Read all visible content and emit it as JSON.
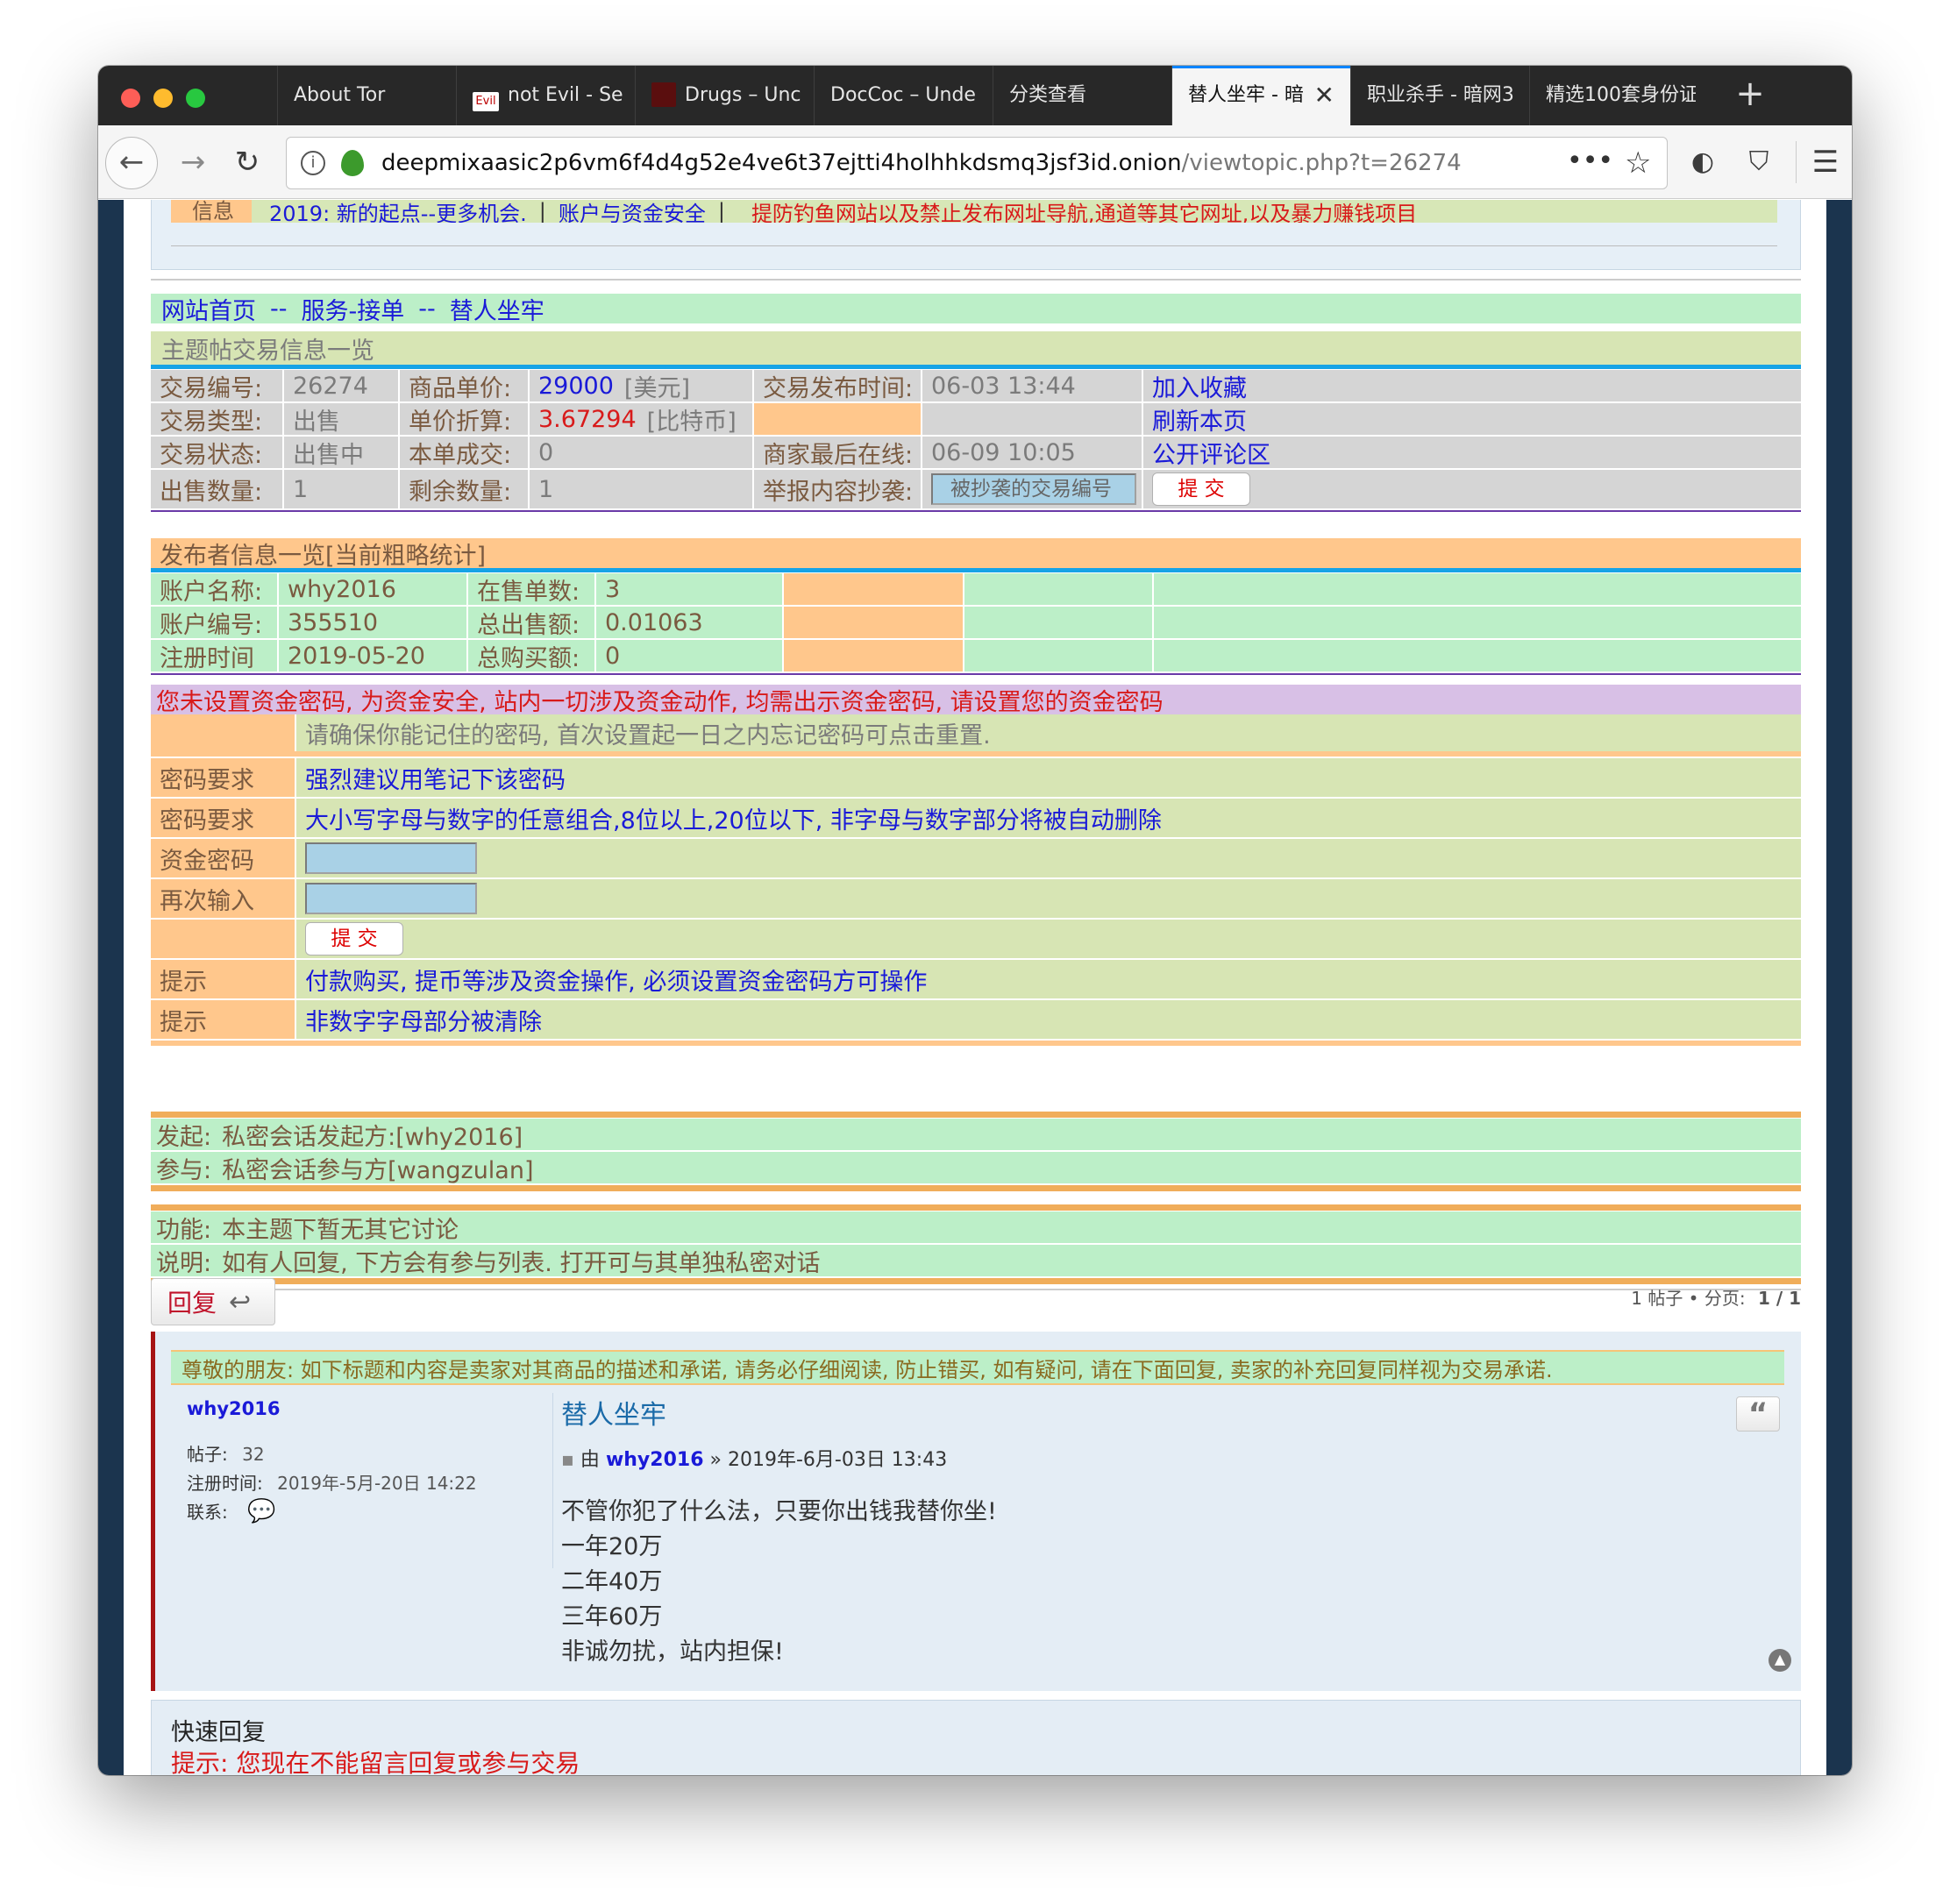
{
  "browser": {
    "tabs": [
      "About Tor",
      "not Evil - Se",
      "Drugs – Unc",
      "DocCoc – Unde",
      "分类查看",
      "替人坐牢 - 暗",
      "职业杀手 - 暗网3",
      "精选100套身份证"
    ],
    "url_host": "deepmixaasic2p6vm6f4d4g52e4ve6t37ejtti4holhhkdsmq3jsf3id.onion",
    "url_path": "/viewtopic.php?t=26274"
  },
  "notice": {
    "label": "信息",
    "item1": "2019: 新的起点--更多机会.",
    "sep1": "|",
    "item2": "账户与资金安全",
    "sep2": "|",
    "item3": "提防钓鱼网站以及禁止发布网址导航,通道等其它网址,以及暴力赚钱项目"
  },
  "breadcrumb": {
    "home": "网站首页",
    "sep": "--",
    "cat": "服务-接单",
    "topic": "替人坐牢"
  },
  "trade": {
    "header": "主题帖交易信息一览",
    "id_label": "交易编号:",
    "id": "26274",
    "price_label": "商品单价:",
    "price": "29000",
    "price_unit": "[美元]",
    "time_label": "交易发布时间:",
    "time": "06-03 13:44",
    "fav": "加入收藏",
    "type_label": "交易类型:",
    "type": "出售",
    "btc_label": "单价折算:",
    "btc": "3.67294",
    "btc_unit": "[比特币]",
    "refresh": "刷新本页",
    "status_label": "交易状态:",
    "status": "出售中",
    "deal_label": "本单成交:",
    "deal": "0",
    "online_label": "商家最后在线:",
    "online": "06-09 10:05",
    "comments": "公开评论区",
    "qty_label": "出售数量:",
    "qty": "1",
    "remain_label": "剩余数量:",
    "remain": "1",
    "report_label": "举报内容抄袭:",
    "report_placeholder": "被抄袭的交易编号",
    "submit": "提 交"
  },
  "seller": {
    "header": "发布者信息一览[当前粗略统计]",
    "name_label": "账户名称:",
    "name": "why2016",
    "onsale_label": "在售单数:",
    "onsale": "3",
    "no_label": "账户编号:",
    "no": "355510",
    "sold_label": "总出售额:",
    "sold": "0.01063",
    "reg_label": "注册时间",
    "reg": "2019-05-20",
    "bought_label": "总购买额:",
    "bought": "0"
  },
  "fundpw": {
    "warning": "您未设置资金密码, 为资金安全, 站内一切涉及资金动作, 均需出示资金密码, 请设置您的资金密码",
    "note": "请确保你能记住的密码, 首次设置起一日之内忘记密码可点击重置.",
    "req_label": "密码要求",
    "req1": "强烈建议用笔记下该密码",
    "req2": "大小写字母与数字的任意组合,8位以上,20位以下, 非字母与数字部分将被自动删除",
    "pw_label": "资金密码",
    "again_label": "再次输入",
    "submit": "提 交",
    "tip_label": "提示",
    "tip1": "付款购买, 提币等涉及资金操作, 必须设置资金密码方可操作",
    "tip2": "非数字字母部分被清除"
  },
  "chat": {
    "start_label": "发起:",
    "start": "私密会话发起方:[why2016]",
    "join_label": "参与:",
    "join": "私密会话参与方[wangzulan]"
  },
  "func": {
    "func_label": "功能:",
    "func": "本主题下暂无其它讨论",
    "desc_label": "说明:",
    "desc": "如有人回复, 下方会有参与列表. 打开可与其单独私密对话"
  },
  "reply_btn": "回复",
  "pagination": {
    "posts": "1 帖子 • 分页:",
    "page": "1 / 1"
  },
  "post": {
    "banner": "尊敬的朋友: 如下标题和内容是卖家对其商品的描述和承诺, 请务必仔细阅读, 防止错买, 如有疑问, 请在下面回复, 卖家的补充回复同样视为交易承诺.",
    "author": "why2016",
    "posts_label": "帖子:",
    "posts": "32",
    "joined_label": "注册时间:",
    "joined": "2019年-5月-20日 14:22",
    "contact_label": "联系:",
    "title": "替人坐牢",
    "by": "由",
    "by_author": "why2016",
    "date": "» 2019年-6月-03日 13:43",
    "lines": [
      "不管你犯了什么法，只要你出钱我替你坐!",
      "一年20万",
      "二年40万",
      "三年60万",
      "非诚勿扰，站内担保!"
    ]
  },
  "quick": {
    "title": "快速回复",
    "hint": "提示: 您现在不能留言回复或参与交易"
  }
}
